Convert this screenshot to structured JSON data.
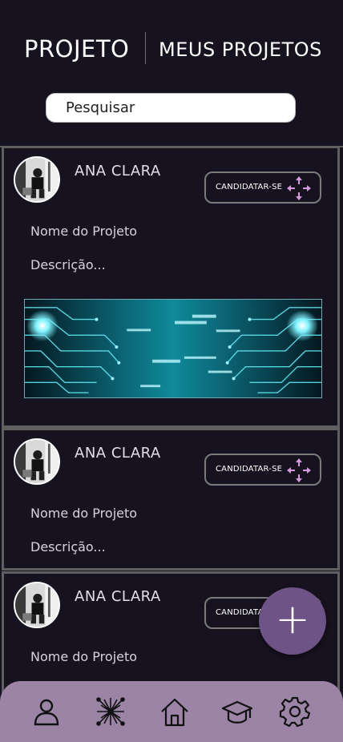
{
  "header": {
    "tabs": [
      {
        "label": "PROJETO"
      },
      {
        "label": "MEUS PROJETOS"
      }
    ],
    "search": {
      "placeholder": "Pesquisar"
    }
  },
  "posts": [
    {
      "user": "ANA CLARA",
      "apply_label": "CANDIDATAR-SE",
      "project_name": "Nome do Projeto",
      "description": "Descrição..."
    },
    {
      "user": "ANA CLARA",
      "apply_label": "CANDIDATAR-SE",
      "project_name": "Nome do Projeto",
      "description": "Descrição..."
    },
    {
      "user": "ANA CLARA",
      "apply_label": "CANDIDATAR-SE",
      "project_name": "Nome do Projeto"
    }
  ],
  "fab": {
    "label": "+"
  },
  "nav": {
    "items": [
      {
        "icon": "user-icon"
      },
      {
        "icon": "network-icon"
      },
      {
        "icon": "home-icon"
      },
      {
        "icon": "graduation-cap-icon"
      },
      {
        "icon": "gear-icon"
      }
    ]
  },
  "colors": {
    "background": "#17121f",
    "nav": "#9b84a6",
    "fab": "#6e5486",
    "apply_icon": "#d59ad9"
  }
}
